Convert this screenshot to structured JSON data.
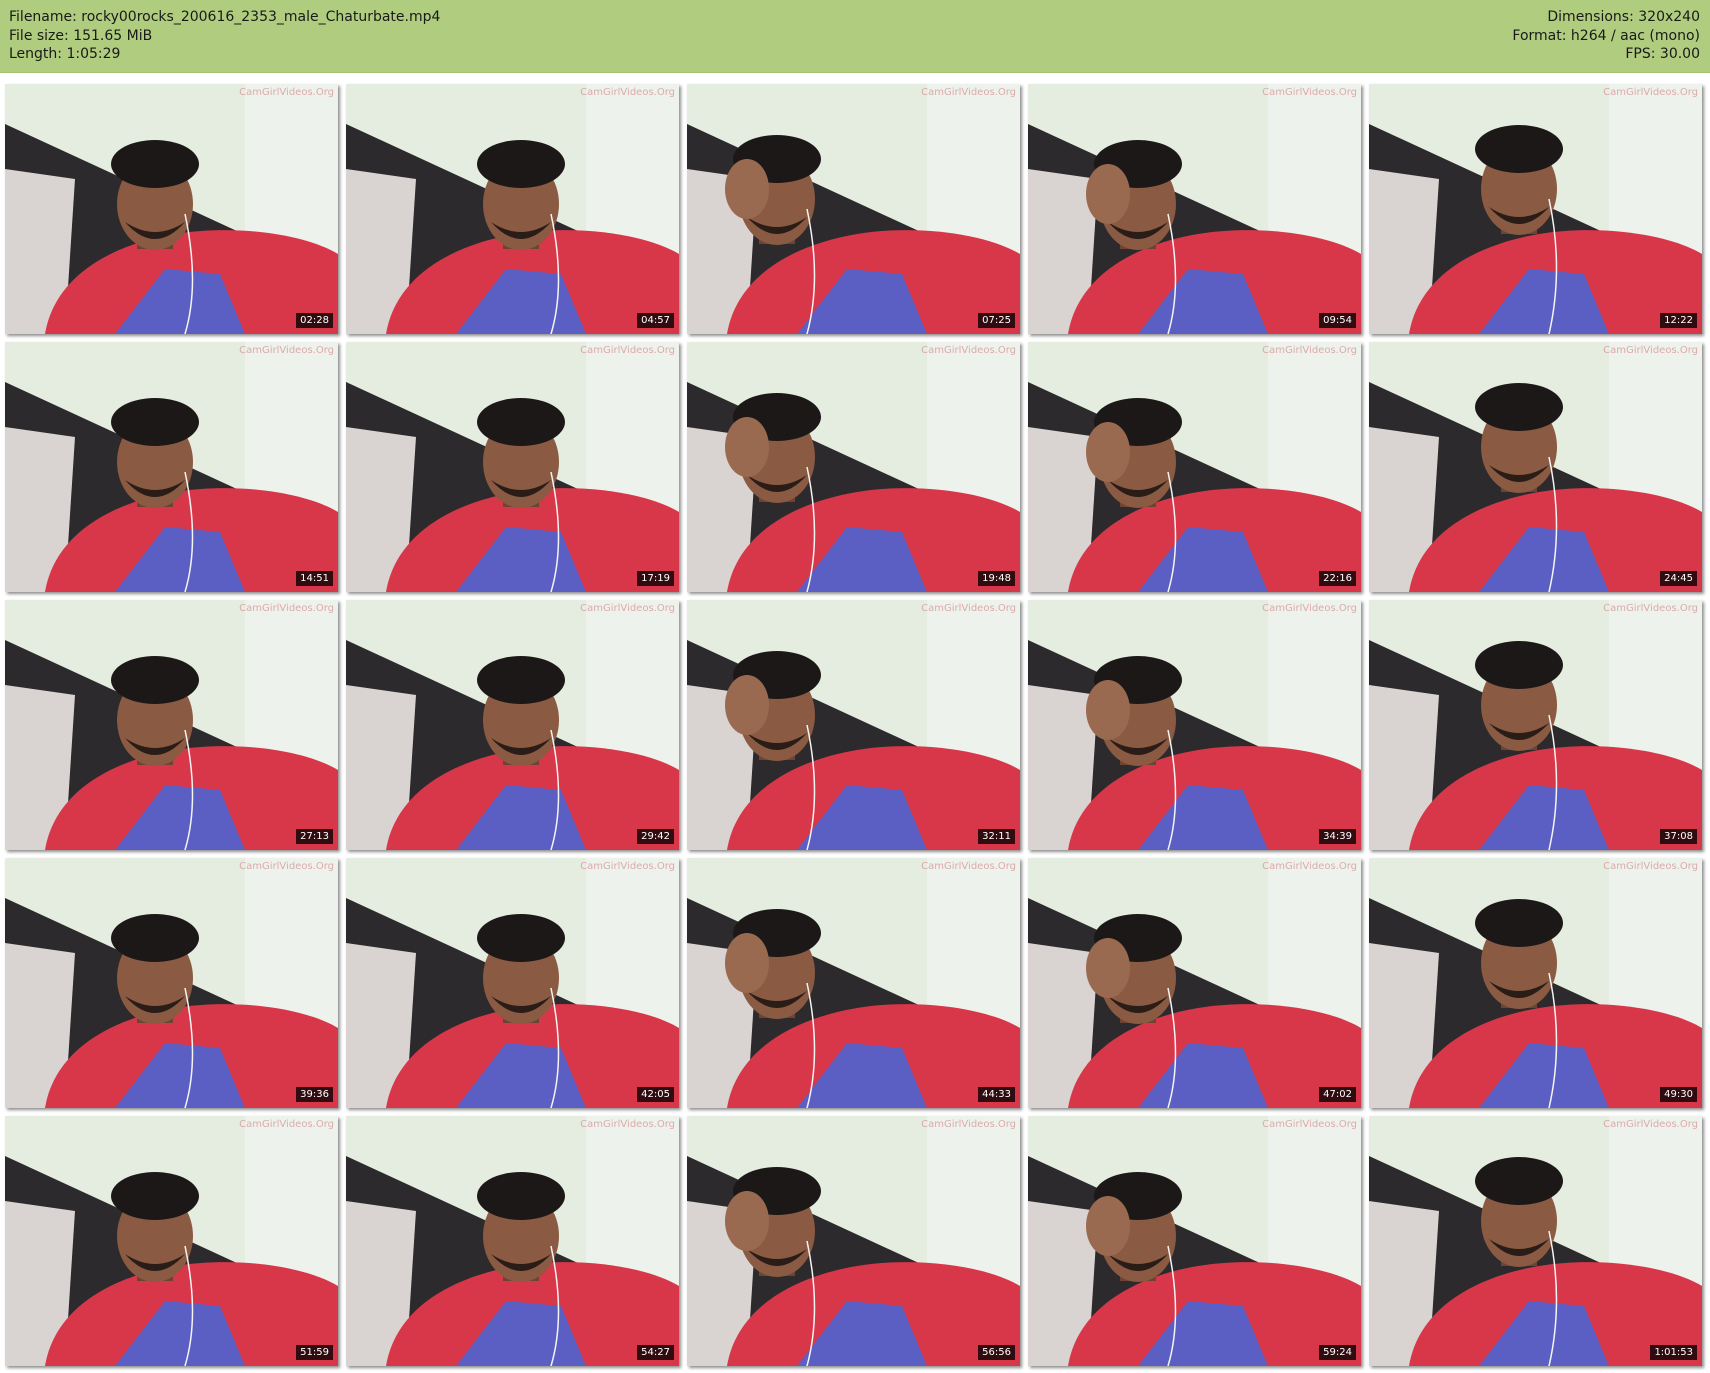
{
  "header": {
    "left": [
      "Filename: rocky00rocks_200616_2353_male_Chaturbate.mp4",
      "File size: 151.65 MiB",
      "Length: 1:05:29"
    ],
    "right": [
      "Dimensions: 320x240",
      "Format: h264 / aac (mono)",
      "FPS: 30.00"
    ]
  },
  "watermark": "CamGirlVideos.Org",
  "thumbnails": [
    {
      "time": "02:28"
    },
    {
      "time": "04:57"
    },
    {
      "time": "07:25"
    },
    {
      "time": "09:54"
    },
    {
      "time": "12:22"
    },
    {
      "time": "14:51"
    },
    {
      "time": "17:19"
    },
    {
      "time": "19:48"
    },
    {
      "time": "22:16"
    },
    {
      "time": "24:45"
    },
    {
      "time": "27:13"
    },
    {
      "time": "29:42"
    },
    {
      "time": "32:11"
    },
    {
      "time": "34:39"
    },
    {
      "time": "37:08"
    },
    {
      "time": "39:36"
    },
    {
      "time": "42:05"
    },
    {
      "time": "44:33"
    },
    {
      "time": "47:02"
    },
    {
      "time": "49:30"
    },
    {
      "time": "51:59"
    },
    {
      "time": "54:27"
    },
    {
      "time": "56:56"
    },
    {
      "time": "59:24"
    },
    {
      "time": "1:01:53"
    }
  ],
  "colors": {
    "header_bg": "#b0cc7e",
    "shirt": "#d8374a",
    "shirt_pattern": "#5b5fc4",
    "wall": "#e6efe0"
  }
}
